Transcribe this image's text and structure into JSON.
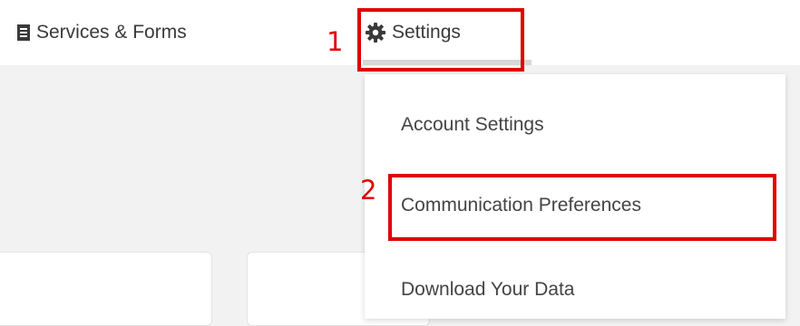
{
  "nav": {
    "services": {
      "label": "Services & Forms",
      "icon": "document-icon"
    },
    "settings": {
      "label": "Settings",
      "icon": "gear-icon"
    }
  },
  "dropdown": {
    "items": [
      {
        "label": "Account Settings"
      },
      {
        "label": "Communication Preferences"
      },
      {
        "label": "Download Your Data"
      }
    ]
  },
  "annotations": {
    "step1": "1",
    "step2": "2",
    "highlight_color": "#e00000"
  }
}
